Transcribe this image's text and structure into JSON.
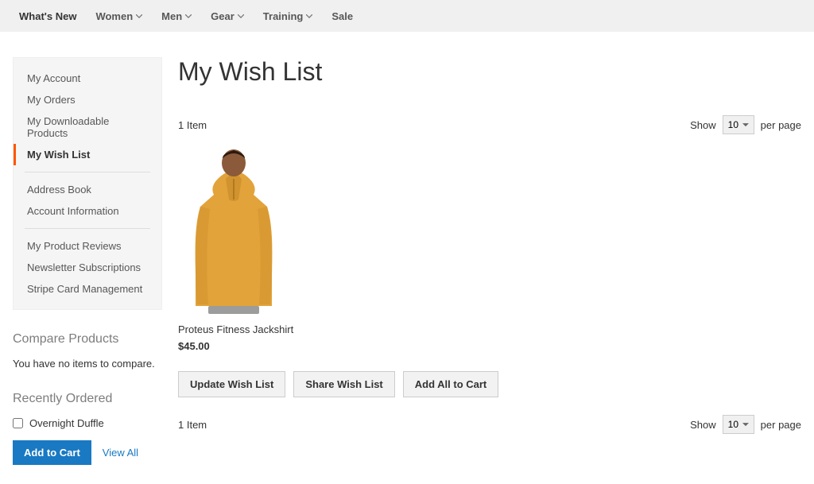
{
  "nav": {
    "items": [
      {
        "label": "What's New",
        "hasChildren": false,
        "active": true
      },
      {
        "label": "Women",
        "hasChildren": true
      },
      {
        "label": "Men",
        "hasChildren": true
      },
      {
        "label": "Gear",
        "hasChildren": true
      },
      {
        "label": "Training",
        "hasChildren": true
      },
      {
        "label": "Sale",
        "hasChildren": false
      }
    ]
  },
  "sidebar": {
    "items": [
      {
        "label": "My Account"
      },
      {
        "label": "My Orders"
      },
      {
        "label": "My Downloadable Products"
      },
      {
        "label": "My Wish List",
        "current": true
      },
      {
        "divider": true
      },
      {
        "label": "Address Book"
      },
      {
        "label": "Account Information"
      },
      {
        "divider": true
      },
      {
        "label": "My Product Reviews"
      },
      {
        "label": "Newsletter Subscriptions"
      },
      {
        "label": "Stripe Card Management"
      }
    ],
    "compare": {
      "title": "Compare Products",
      "empty_text": "You have no items to compare."
    },
    "recently_ordered": {
      "title": "Recently Ordered",
      "items": [
        {
          "label": "Overnight Duffle",
          "checked": false
        }
      ],
      "add_label": "Add to Cart",
      "view_all_label": "View All"
    }
  },
  "page": {
    "title": "My Wish List"
  },
  "toolbar": {
    "count_text": "1 Item",
    "show_label": "Show",
    "limiter_value": "10",
    "per_page_label": "per page"
  },
  "wishlist": {
    "items": [
      {
        "name": "Proteus Fitness Jackshirt",
        "price": "$45.00"
      }
    ],
    "actions": {
      "update_label": "Update Wish List",
      "share_label": "Share Wish List",
      "add_all_label": "Add All to Cart"
    }
  }
}
